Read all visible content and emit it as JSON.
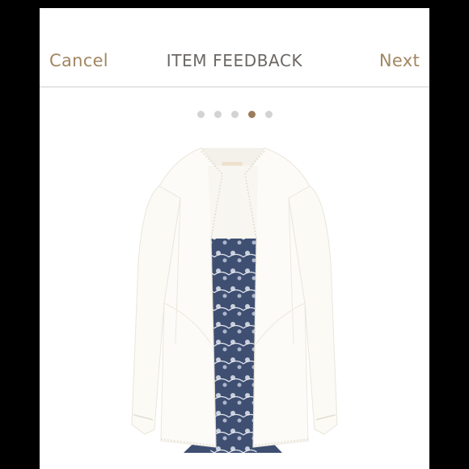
{
  "navbar": {
    "cancel_label": "Cancel",
    "title": "ITEM FEEDBACK",
    "next_label": "Next"
  },
  "pager": {
    "total": 5,
    "active_index": 3
  },
  "colors": {
    "accent": "#a28662",
    "title": "#6b6764",
    "dot_inactive": "#d3d3d3",
    "dot_active": "#9a7d5c"
  }
}
